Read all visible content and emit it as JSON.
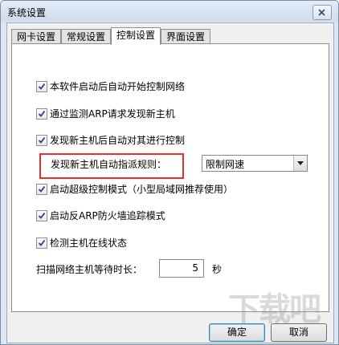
{
  "window": {
    "title": "系统设置"
  },
  "tabs": [
    {
      "label": "网卡设置",
      "active": false
    },
    {
      "label": "常规设置",
      "active": false
    },
    {
      "label": "控制设置",
      "active": true
    },
    {
      "label": "界面设置",
      "active": false
    }
  ],
  "options": [
    {
      "label": "本软件启动后自动开始控制网络",
      "checked": true
    },
    {
      "label": "通过监测ARP请求发现新主机",
      "checked": true
    },
    {
      "label": "发现新主机后自动对其进行控制",
      "checked": true
    },
    {
      "label": "启动超级控制模式（小型局域网推荐使用）",
      "checked": true
    },
    {
      "label": "启动反ARP防火墙追踪模式",
      "checked": true
    },
    {
      "label": "检测主机在线状态",
      "checked": true
    }
  ],
  "rule": {
    "label": "发现新主机自动指派规则：",
    "selected": "限制网速"
  },
  "scan": {
    "label": "扫描网络主机等待时长：",
    "value": "5",
    "unit": "秒"
  },
  "buttons": {
    "ok": "确定",
    "cancel": "取消"
  },
  "watermark": "下载吧",
  "colors": {
    "highlight": "#e03030",
    "accent": "#3c7fb1"
  }
}
